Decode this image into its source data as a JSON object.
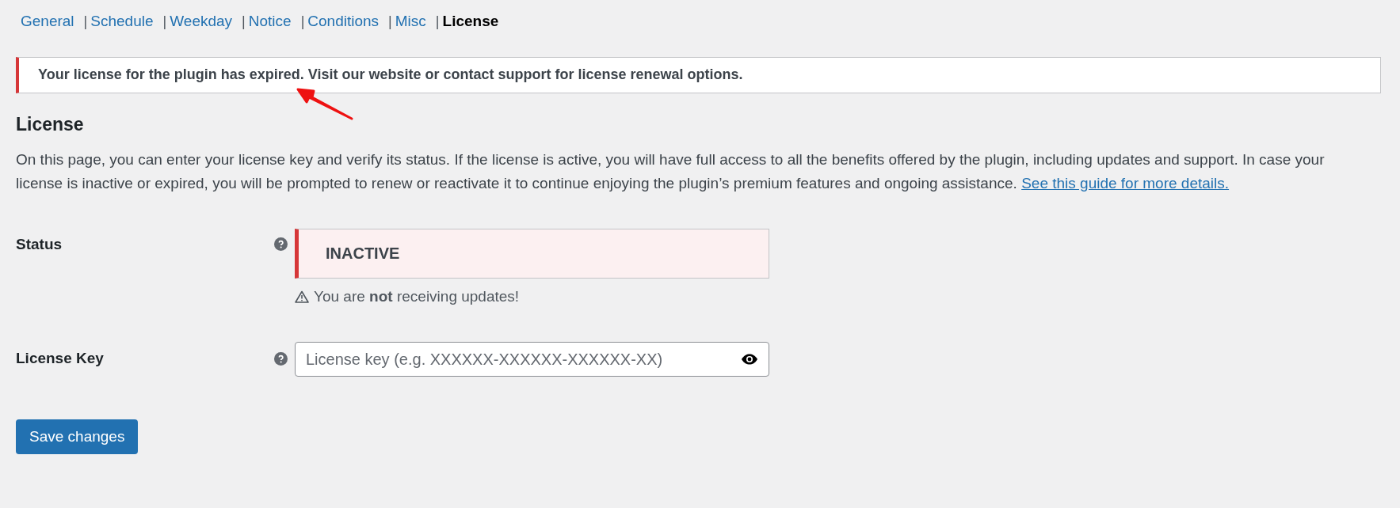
{
  "tabs": [
    {
      "label": "General",
      "selected": false
    },
    {
      "separator": "|",
      "label": "Schedule",
      "selected": false
    },
    {
      "separator": "|",
      "label": "Weekday",
      "selected": false
    },
    {
      "separator": "|",
      "label": "Notice",
      "selected": false
    },
    {
      "separator": "|",
      "label": "Conditions",
      "selected": false
    },
    {
      "separator": "|",
      "label": "Misc",
      "selected": false
    },
    {
      "separator": "|",
      "label": "License",
      "selected": true
    }
  ],
  "notice": {
    "kind": "error",
    "text": "Your license for the plugin has expired. Visit our website or contact support for license renewal options."
  },
  "heading": "License",
  "description": {
    "text": "On this page, you can enter your license key and verify its status. If the license is active, you will have full access to all the benefits offered by the plugin, including updates and support. In case your license is inactive or expired, you will be prompted to renew or reactivate it to continue enjoying the plugin’s premium features and ongoing assistance.",
    "link": "See this guide for more details."
  },
  "fields": [
    {
      "kind": "status",
      "label": "Status",
      "value": "INACTIVE",
      "active": false,
      "warning": "You are **not** receiving updates!"
    },
    {
      "kind": "input",
      "label": "License Key",
      "placeholder": "License key (e.g. XXXXXX-XXXXXX-XXXXXX-XX)"
    }
  ],
  "save_button": "Save changes"
}
